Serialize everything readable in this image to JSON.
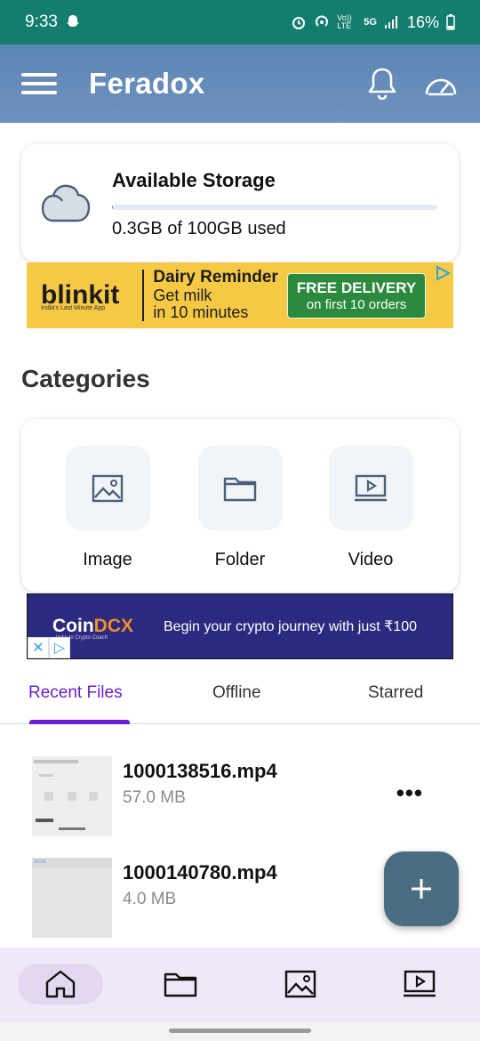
{
  "status_bar": {
    "time": "9:33",
    "network": "Vo)) LTE",
    "signal_type": "5G",
    "battery": "16%"
  },
  "app_bar": {
    "title": "Feradox"
  },
  "storage": {
    "title": "Available Storage",
    "used_text": "0.3GB of 100GB used",
    "used_fraction": 0.003
  },
  "ad_blinkit": {
    "brand": "blinkit",
    "tagline": "India's Last Minute App",
    "headline": "Dairy Reminder",
    "line1": "Get milk",
    "line2": "in 10 minutes",
    "cta_main": "FREE DELIVERY",
    "cta_sub": "on first 10 orders"
  },
  "categories": {
    "title": "Categories",
    "items": [
      {
        "label": "Image",
        "icon": "image-icon"
      },
      {
        "label": "Folder",
        "icon": "folder-icon"
      },
      {
        "label": "Video",
        "icon": "video-icon"
      }
    ]
  },
  "ad_coindcx": {
    "brand_a": "Coin",
    "brand_b": "DCX",
    "sub": "India to Crypto Coach",
    "message": "Begin your crypto journey with just ₹100"
  },
  "tabs": [
    {
      "label": "Recent Files",
      "active": true
    },
    {
      "label": "Offline",
      "active": false
    },
    {
      "label": "Starred",
      "active": false
    }
  ],
  "files": [
    {
      "name": "1000138516.mp4",
      "size": "57.0 MB"
    },
    {
      "name": "1000140780.mp4",
      "size": "4.0 MB"
    }
  ],
  "colors": {
    "status_bar": "#137d6e",
    "app_bar": "#5b86b6",
    "accent": "#6a1fd4",
    "fab": "#4a6d81",
    "nav_bg": "#f0e8f7"
  }
}
